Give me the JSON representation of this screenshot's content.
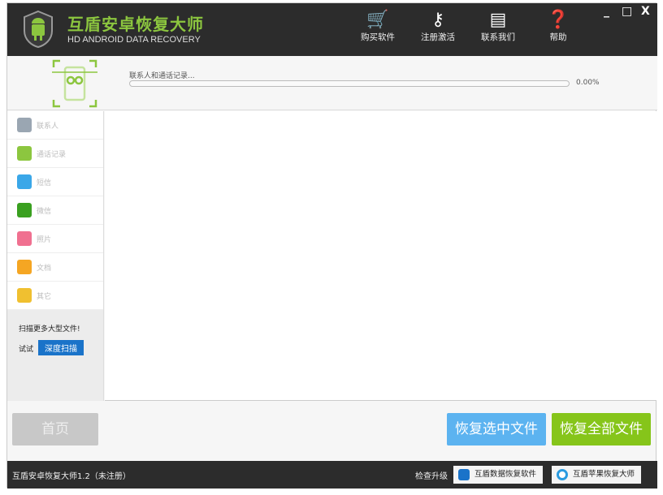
{
  "app": {
    "title": "互盾安卓恢复大师",
    "subtitle": "HD ANDROID DATA RECOVERY"
  },
  "toolbar": [
    {
      "icon": "cart-icon",
      "label": "购买软件"
    },
    {
      "icon": "key-icon",
      "label": "注册激活"
    },
    {
      "icon": "chat-icon",
      "label": "联系我们"
    },
    {
      "icon": "help-icon",
      "label": "帮助"
    }
  ],
  "window_controls": {
    "minimize": "_",
    "maximize": "□",
    "close": "X"
  },
  "scan": {
    "label": "联系人和通话记录...",
    "percent_text": "0.00%",
    "progress": 0
  },
  "sidebar": {
    "items": [
      {
        "label": "联系人",
        "icon": "contacts-icon",
        "color": "#9aa6b2"
      },
      {
        "label": "通话记录",
        "icon": "phone-icon",
        "color": "#8cc63f"
      },
      {
        "label": "短信",
        "icon": "sms-icon",
        "color": "#3aa7e8"
      },
      {
        "label": "微信",
        "icon": "wechat-icon",
        "color": "#3aa020"
      },
      {
        "label": "照片",
        "icon": "photo-icon",
        "color": "#f07090"
      },
      {
        "label": "文档",
        "icon": "document-icon",
        "color": "#f5a623"
      },
      {
        "label": "其它",
        "icon": "other-icon",
        "color": "#f0c030"
      }
    ],
    "deep_scan_text": "扫描更多大型文件!",
    "try_text": "试试",
    "deep_scan_button": "深度扫描"
  },
  "buttons": {
    "home": "首页",
    "recover_selected": "恢复选中文件",
    "recover_all": "恢复全部文件"
  },
  "status": {
    "version": "互盾安卓恢复大师1.2（未注册）",
    "check_update": "检查升级",
    "link1": "互盾数据恢复软件",
    "link2": "互盾苹果恢复大师"
  }
}
